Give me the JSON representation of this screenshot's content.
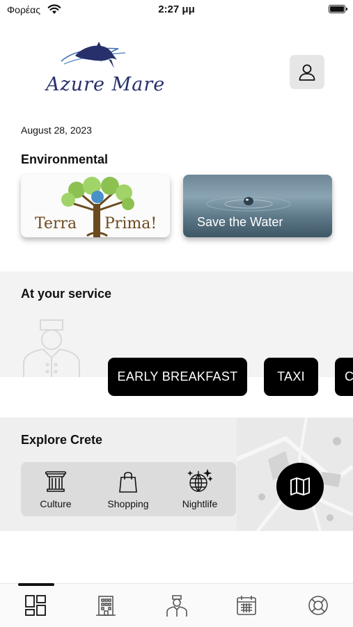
{
  "status_bar": {
    "carrier": "Φορέας",
    "time": "2:27 μμ"
  },
  "header": {
    "logo_text": "Azure Mare",
    "profile_icon": "person-icon"
  },
  "date": "August 28, 2023",
  "environmental": {
    "title": "Environmental",
    "cards": [
      {
        "label_left": "Terra",
        "label_right": "Prima!"
      },
      {
        "label": "Save the Water"
      }
    ]
  },
  "service": {
    "title": "At your service",
    "buttons": [
      "EARLY BREAKFAST",
      "TAXI",
      "C"
    ]
  },
  "explore": {
    "title": "Explore Crete",
    "categories": [
      {
        "label": "Culture",
        "icon": "column-icon"
      },
      {
        "label": "Shopping",
        "icon": "shopping-bag-icon"
      },
      {
        "label": "Nightlife",
        "icon": "disco-ball-icon"
      }
    ],
    "map_icon": "map-icon"
  },
  "tabs": [
    {
      "icon": "dashboard-icon",
      "active": true
    },
    {
      "icon": "hotel-icon",
      "active": false
    },
    {
      "icon": "concierge-icon",
      "active": false
    },
    {
      "icon": "calendar-icon",
      "active": false
    },
    {
      "icon": "lifebuoy-icon",
      "active": false
    }
  ]
}
